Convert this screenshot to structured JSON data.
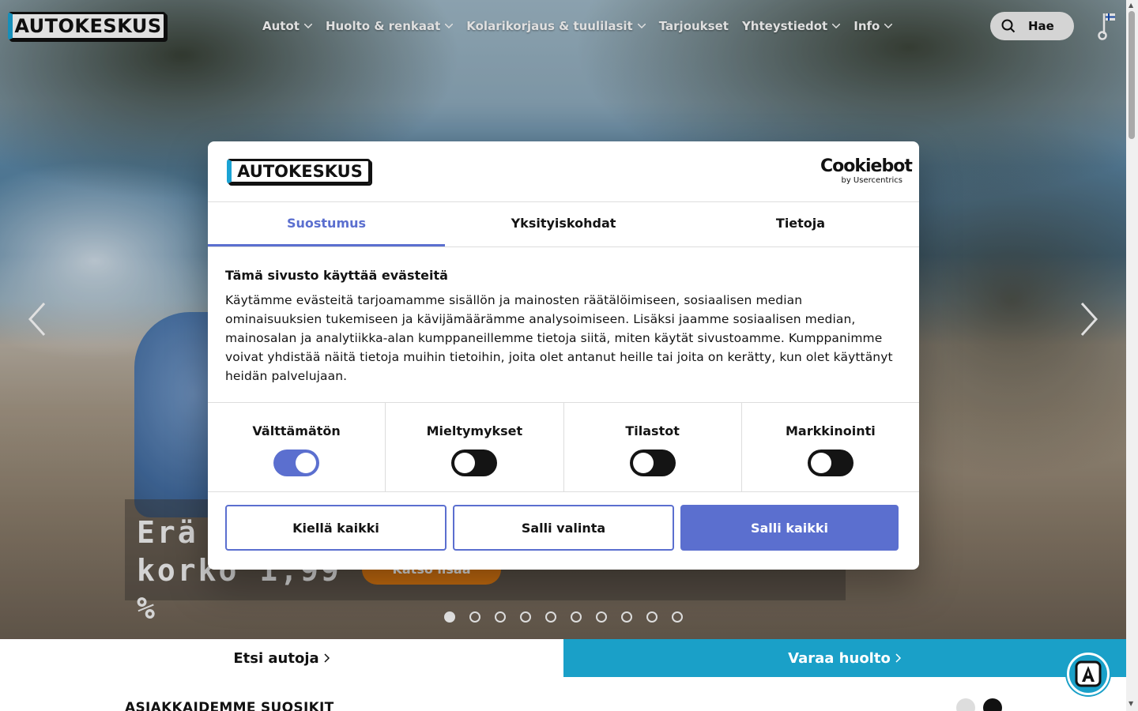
{
  "header": {
    "logo_text": "AUTOKESKUS",
    "nav": [
      {
        "label": "Autot",
        "has_dropdown": true
      },
      {
        "label": "Huolto & renkaat",
        "has_dropdown": true
      },
      {
        "label": "Kolarikorjaus & tuulilasit",
        "has_dropdown": true
      },
      {
        "label": "Tarjoukset",
        "has_dropdown": false
      },
      {
        "label": "Yhteystiedot",
        "has_dropdown": true
      },
      {
        "label": "Info",
        "has_dropdown": true
      }
    ],
    "search_label": "Hae",
    "icons": [
      "search-icon",
      "key-icon",
      "finnish-flag-icon"
    ]
  },
  "hero": {
    "caption": "Erä Ioniq korko 1,99 %",
    "caption_line1": "Erä I",
    "caption_line2": "korko 1,99 %",
    "caption_button": "Katso lisää",
    "slide_count": 10,
    "active_slide": 1
  },
  "cookie_dialog": {
    "brand_logo": "AUTOKESKUS",
    "provider_logo": "Cookiebot",
    "provider_sub": "by Usercentrics",
    "tabs": [
      {
        "label": "Suostumus",
        "active": true
      },
      {
        "label": "Yksityiskohdat",
        "active": false
      },
      {
        "label": "Tietoja",
        "active": false
      }
    ],
    "title": "Tämä sivusto käyttää evästeitä",
    "body": "Käytämme evästeitä tarjoamamme sisällön ja mainosten räätälöimiseen, sosiaalisen median ominaisuuksien tukemiseen ja kävijämäärämme analysoimiseen. Lisäksi jaamme sosiaalisen median, mainosalan ja analytiikka-alan kumppaneillemme tietoja siitä, miten käytät sivustoamme. Kumppanimme voivat yhdistää näitä tietoja muihin tietoihin, joita olet antanut heille tai joita on kerätty, kun olet käyttänyt heidän palvelujaan.",
    "categories": [
      {
        "label": "Välttämätön",
        "enabled": true
      },
      {
        "label": "Mieltymykset",
        "enabled": false
      },
      {
        "label": "Tilastot",
        "enabled": false
      },
      {
        "label": "Markkinointi",
        "enabled": false
      }
    ],
    "buttons": {
      "deny": "Kiellä kaikki",
      "allow_selection": "Salli valinta",
      "allow_all": "Salli kaikki"
    },
    "accent_color": "#5b6fcf"
  },
  "cta": {
    "left": "Etsi autoja",
    "right": "Varaa huolto",
    "right_color": "#1aa0c8"
  },
  "section": {
    "heading": "ASIAKKAIDEMME SUOSIKIT"
  }
}
